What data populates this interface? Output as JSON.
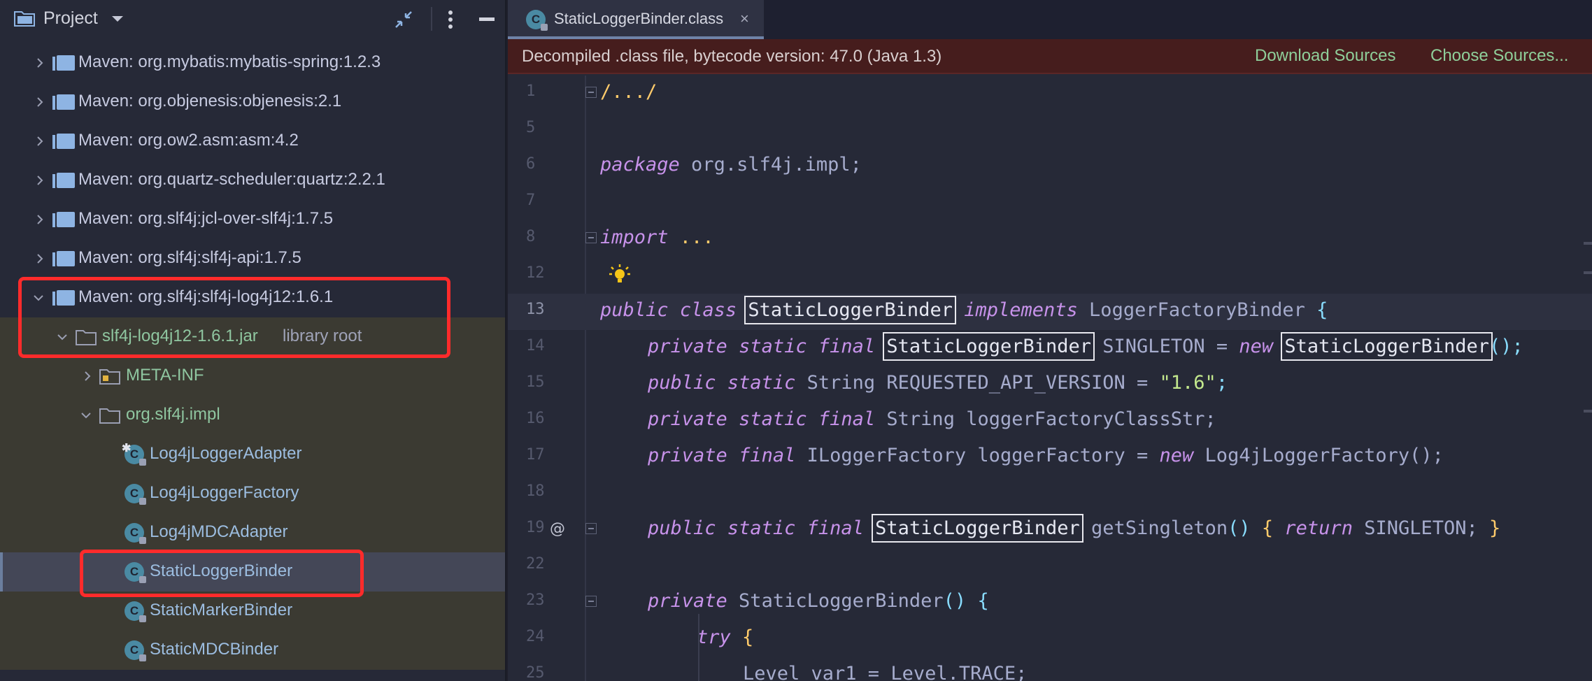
{
  "project_panel": {
    "title": "Project",
    "items": [
      {
        "label": "Maven: org.mybatis:mybatis-spring:1.2.3"
      },
      {
        "label": "Maven: org.objenesis:objenesis:2.1"
      },
      {
        "label": "Maven: org.ow2.asm:asm:4.2"
      },
      {
        "label": "Maven: org.quartz-scheduler:quartz:2.2.1"
      },
      {
        "label": "Maven: org.slf4j:jcl-over-slf4j:1.7.5"
      },
      {
        "label": "Maven: org.slf4j:slf4j-api:1.7.5"
      },
      {
        "label": "Maven: org.slf4j:slf4j-log4j12:1.6.1"
      }
    ],
    "jar": {
      "label": "slf4j-log4j12-1.6.1.jar",
      "suffix": "library root"
    },
    "folders": {
      "meta_inf": "META-INF",
      "package": "org.slf4j.impl"
    },
    "classes": [
      {
        "label": "Log4jLoggerAdapter"
      },
      {
        "label": "Log4jLoggerFactory"
      },
      {
        "label": "Log4jMDCAdapter"
      },
      {
        "label": "StaticLoggerBinder"
      },
      {
        "label": "StaticMarkerBinder"
      },
      {
        "label": "StaticMDCBinder"
      }
    ]
  },
  "editor": {
    "tab": {
      "label": "StaticLoggerBinder.class",
      "icon": "C",
      "close": "×"
    },
    "banner": {
      "text": "Decompiled .class file, bytecode version: 47.0 (Java 1.3)",
      "download_sources": "Download Sources",
      "choose_sources": "Choose Sources..."
    },
    "line_numbers": [
      "1",
      "5",
      "6",
      "7",
      "8",
      "12",
      "13",
      "14",
      "15",
      "16",
      "17",
      "18",
      "19",
      "22",
      "23",
      "24",
      "25"
    ],
    "code": {
      "l1": "/.../",
      "l6_kw": "package",
      "l6_rest": " org.slf4j.impl;",
      "l8_kw": "import",
      "l8_rest": " ...",
      "public": "public",
      "class": "class",
      "private": "private",
      "static": "static",
      "final": "final",
      "new": "new",
      "implements": "implements",
      "return": "return",
      "try": "try",
      "class_name": "StaticLoggerBinder",
      "factory_binder": " LoggerFactoryBinder ",
      "open_brace": "{",
      "close_brace": "}",
      "l14_mid": " SINGLETON = ",
      "l14_end": "();",
      "l15_mid": " String REQUESTED_API_VERSION = ",
      "l15_str": "\"1.6\"",
      "l15_end": ";",
      "l16_mid": " String loggerFactoryClassStr;",
      "l17_mid": " ILoggerFactory loggerFactory = ",
      "l17_end": " Log4jLoggerFactory();",
      "l19_mid": " getSingleton",
      "l19_parens": "()",
      "l19_ret": " SINGLETON; ",
      "l23_ctor": " StaticLoggerBinder",
      "l25": "Level var1 = Level.TRACE;"
    }
  },
  "colors": {
    "highlight_box": "#ff2b2b",
    "banner_bg": "#461d1d",
    "link": "#8fcf9a"
  }
}
